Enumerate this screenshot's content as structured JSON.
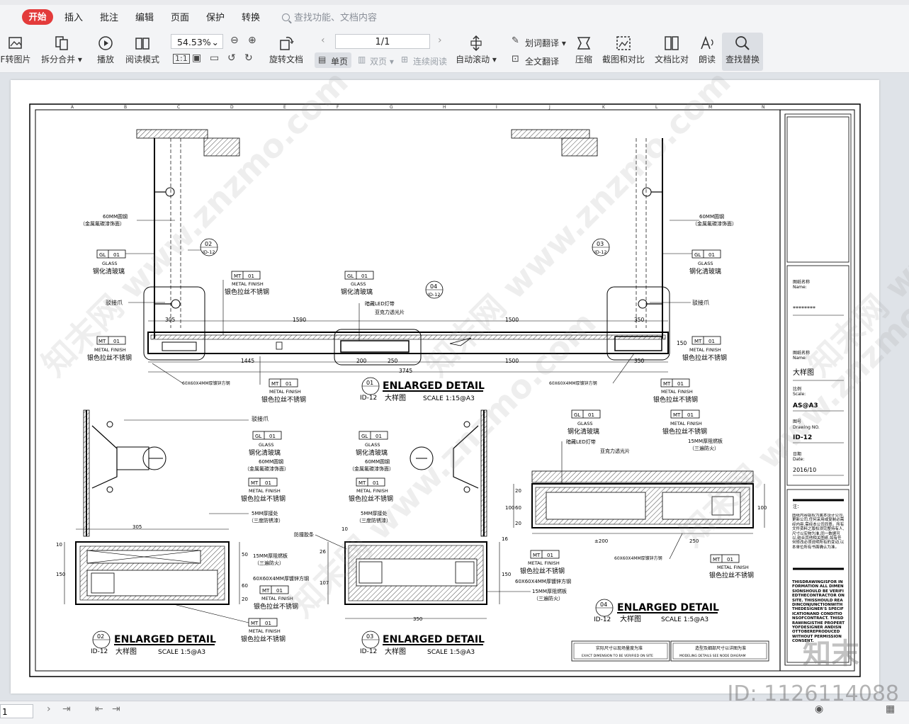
{
  "menu": {
    "start": "开始",
    "tabs": [
      "插入",
      "批注",
      "编辑",
      "页面",
      "保护",
      "转换"
    ],
    "search_placeholder": "查找功能、文档内容"
  },
  "toolbar": {
    "pdf_to_image": "F转图片",
    "split_merge": "拆分合并",
    "play": "播放",
    "read_mode": "阅读模式",
    "zoom": "54.53%",
    "rotate_doc": "旋转文档",
    "page_indicator": "1/1",
    "single_page": "单页",
    "double_page": "双页",
    "continuous": "连续阅读",
    "auto_scroll": "自动滚动",
    "word_translate": "划词翻译",
    "full_translate": "全文翻译",
    "compress": "压缩",
    "screenshot_compare": "截图和对比",
    "doc_compare": "文档比对",
    "read_aloud": "朗读",
    "find_replace": "查找替换"
  },
  "drawing": {
    "labels": {
      "round_steel": "60MM圆钢",
      "fluorocarbon": "（金属氟碳漆饰面）",
      "gl": "GL",
      "mt": "MT",
      "code01": "01",
      "glass": "GLASS",
      "tempered_glass": "钢化清玻璃",
      "metal_finish": "METAL FINISH",
      "brushed_ss": "银色拉丝不锈钢",
      "spider": "驳接爪",
      "hidden_led": "暗藏LED灯带",
      "acrylic": "亚克力透光片",
      "square_tube": "60X60X4MM厚镀锌方钢",
      "fireproof_board": "15MM厚阻燃板",
      "three_coat": "（三遍防火）",
      "steel_plate": "5MM厚接处",
      "three_anti": "（三度防锈漆）",
      "glue_strip": "防撞胶条"
    },
    "dims": {
      "d305": "305",
      "d1590": "1590",
      "d1500": "1500",
      "d350": "350",
      "d1445": "1445",
      "d200": "200",
      "d250": "250",
      "d3745": "3745",
      "d150": "150",
      "d50": "50",
      "d60": "60",
      "d20": "20",
      "d100": "100",
      "d107": "107",
      "d26": "26",
      "d10": "10",
      "d16": "16",
      "d200pm": "±200"
    },
    "bubbles": {
      "b02": "02",
      "b03": "03",
      "b04": "04",
      "id12": "ID-12",
      "b01": "01"
    },
    "details": {
      "title": "ENLARGED DETAIL",
      "cn": "大样图",
      "scale_main": "SCALE 1:15@A3",
      "scale_small": "SCALE 1:5@A3"
    },
    "notes": {
      "site_cn": "实际尺寸以现场量度为准",
      "site_en": "EXACT DIMENSION TO BE VERIFIED ON SITE",
      "model_cn": "造型及细部尺寸以详图为准",
      "model_en": "MODELING DETAILS SEE NODE DIAGRAM"
    },
    "title_block": {
      "name_cn1": "图纸名称",
      "name_en1": "Name:",
      "name_value1": "********",
      "name_cn2": "图纸名称",
      "name_en2": "Name:",
      "name_value2": "大样图",
      "scale_cn": "比例",
      "scale_en": "Scale:",
      "scale_value": "AS@A3",
      "drawing_no_cn": "图号",
      "drawing_no_en": "Drawing NO.",
      "drawing_no_value": "ID-12",
      "date_cn": "日期",
      "date_en": "Date:",
      "date_value": "2016/10",
      "note_label": "注：",
      "note_cn": "图纸内容版权为属本设计公司,更新公司,任何采用或复制必需经内容,需经本公司同意。所有文件资料之版权须完整持有人,尺寸以实物为准,同一数据可以,结合其他相关图纸,如有任何修改必须说明所有的变动,以本单位所有书面确认为准。",
      "note_en": "THISDRAWINGISFOR INFORMATION ALL DIMENSIONSHOULD BE VERIFIEDTHECONTRACTOR ONSITE. THISSHOULD READINCONJUNCTIONWITH THEDESIGNER'S SPECIFICATIONAND CONDITIONSOFCONTRACT. THISDRAWINGISTHE PROPERTYOFDESIGNER ANDISNOTTOBEREPRODUCED WITHOUT PERMISSION CONSENT."
    },
    "grid_letters": [
      "A",
      "B",
      "C",
      "D",
      "E",
      "F",
      "G",
      "H",
      "I",
      "J",
      "K",
      "L",
      "M",
      "N"
    ]
  },
  "watermarks": {
    "site": "知末网 www.znzmo.com",
    "brand": "知末",
    "id": "ID: 1126114088"
  },
  "status": {
    "page_input": "1"
  }
}
